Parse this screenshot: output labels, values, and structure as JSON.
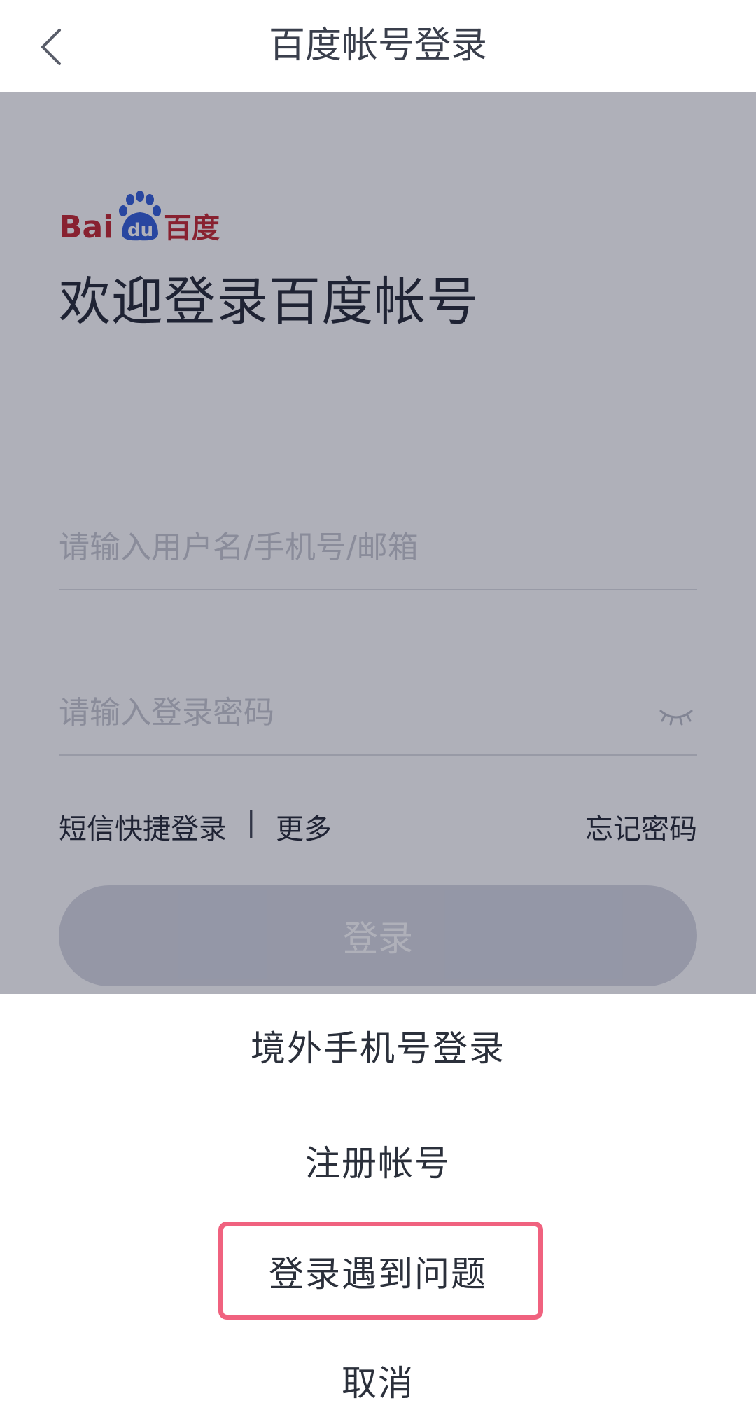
{
  "header": {
    "title": "百度帐号登录",
    "back_icon": "chevron-left-icon"
  },
  "logo": {
    "text_latin": "Bai",
    "text_du": "du",
    "text_cn": "百度",
    "brand_red": "#c3202a",
    "brand_blue": "#2c5ad8"
  },
  "login": {
    "welcome": "欢迎登录百度帐号",
    "username_placeholder": "请输入用户名/手机号/邮箱",
    "password_placeholder": "请输入登录密码",
    "password_icon": "eye-closed-icon",
    "sms_login": "短信快捷登录",
    "separator": "|",
    "more": "更多",
    "forgot_password": "忘记密码",
    "submit_label": "登录"
  },
  "sheet": {
    "overseas_phone_login": "境外手机号登录",
    "register": "注册帐号",
    "login_problem": "登录遇到问题",
    "cancel": "取消",
    "highlight_color": "#f0627f"
  }
}
